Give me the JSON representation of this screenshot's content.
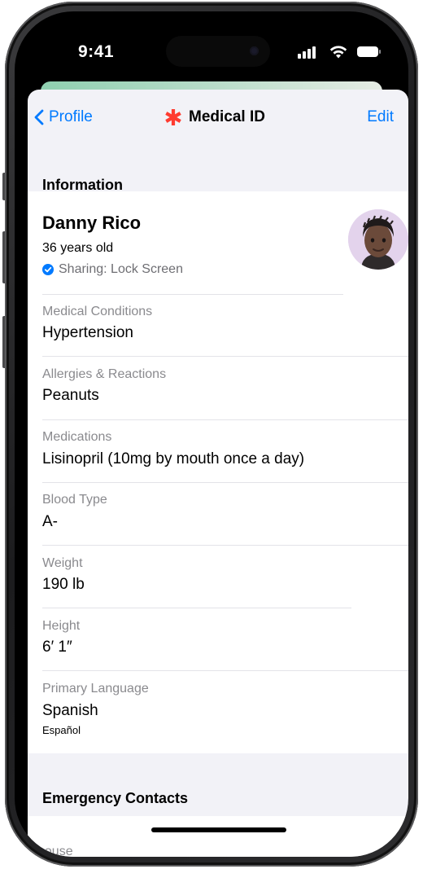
{
  "status_bar": {
    "time": "9:41"
  },
  "nav": {
    "back_label": "Profile",
    "title": "Medical ID",
    "edit_label": "Edit"
  },
  "colors": {
    "accent": "#007aff",
    "medical_star": "#ff3b30",
    "label_gray": "#8a8a8e",
    "sheet_background": "#f2f2f7",
    "avatar_background": "#e3d3ec"
  },
  "icons": {
    "back": "chevron-left-icon",
    "title": "medical-star-icon",
    "sharing": "checkmark-circle-icon",
    "avatar": "memoji-avatar"
  },
  "information": {
    "header": "Information",
    "name": "Danny Rico",
    "age": "36 years old",
    "sharing": "Sharing: Lock Screen",
    "fields": [
      {
        "label": "Medical Conditions",
        "value": "Hypertension"
      },
      {
        "label": "Allergies & Reactions",
        "value": "Peanuts"
      },
      {
        "label": "Medications",
        "value": "Lisinopril (10mg by mouth once a day)"
      },
      {
        "label": "Blood Type",
        "value": "A-"
      },
      {
        "label": "Weight",
        "value": "190 lb"
      },
      {
        "label": "Height",
        "value": "6′ 1″"
      },
      {
        "label": "Primary Language",
        "value": "Spanish",
        "subvalue": "Español"
      }
    ]
  },
  "emergency_contacts": {
    "header": "Emergency Contacts",
    "first_contact_partial": "pouse"
  }
}
